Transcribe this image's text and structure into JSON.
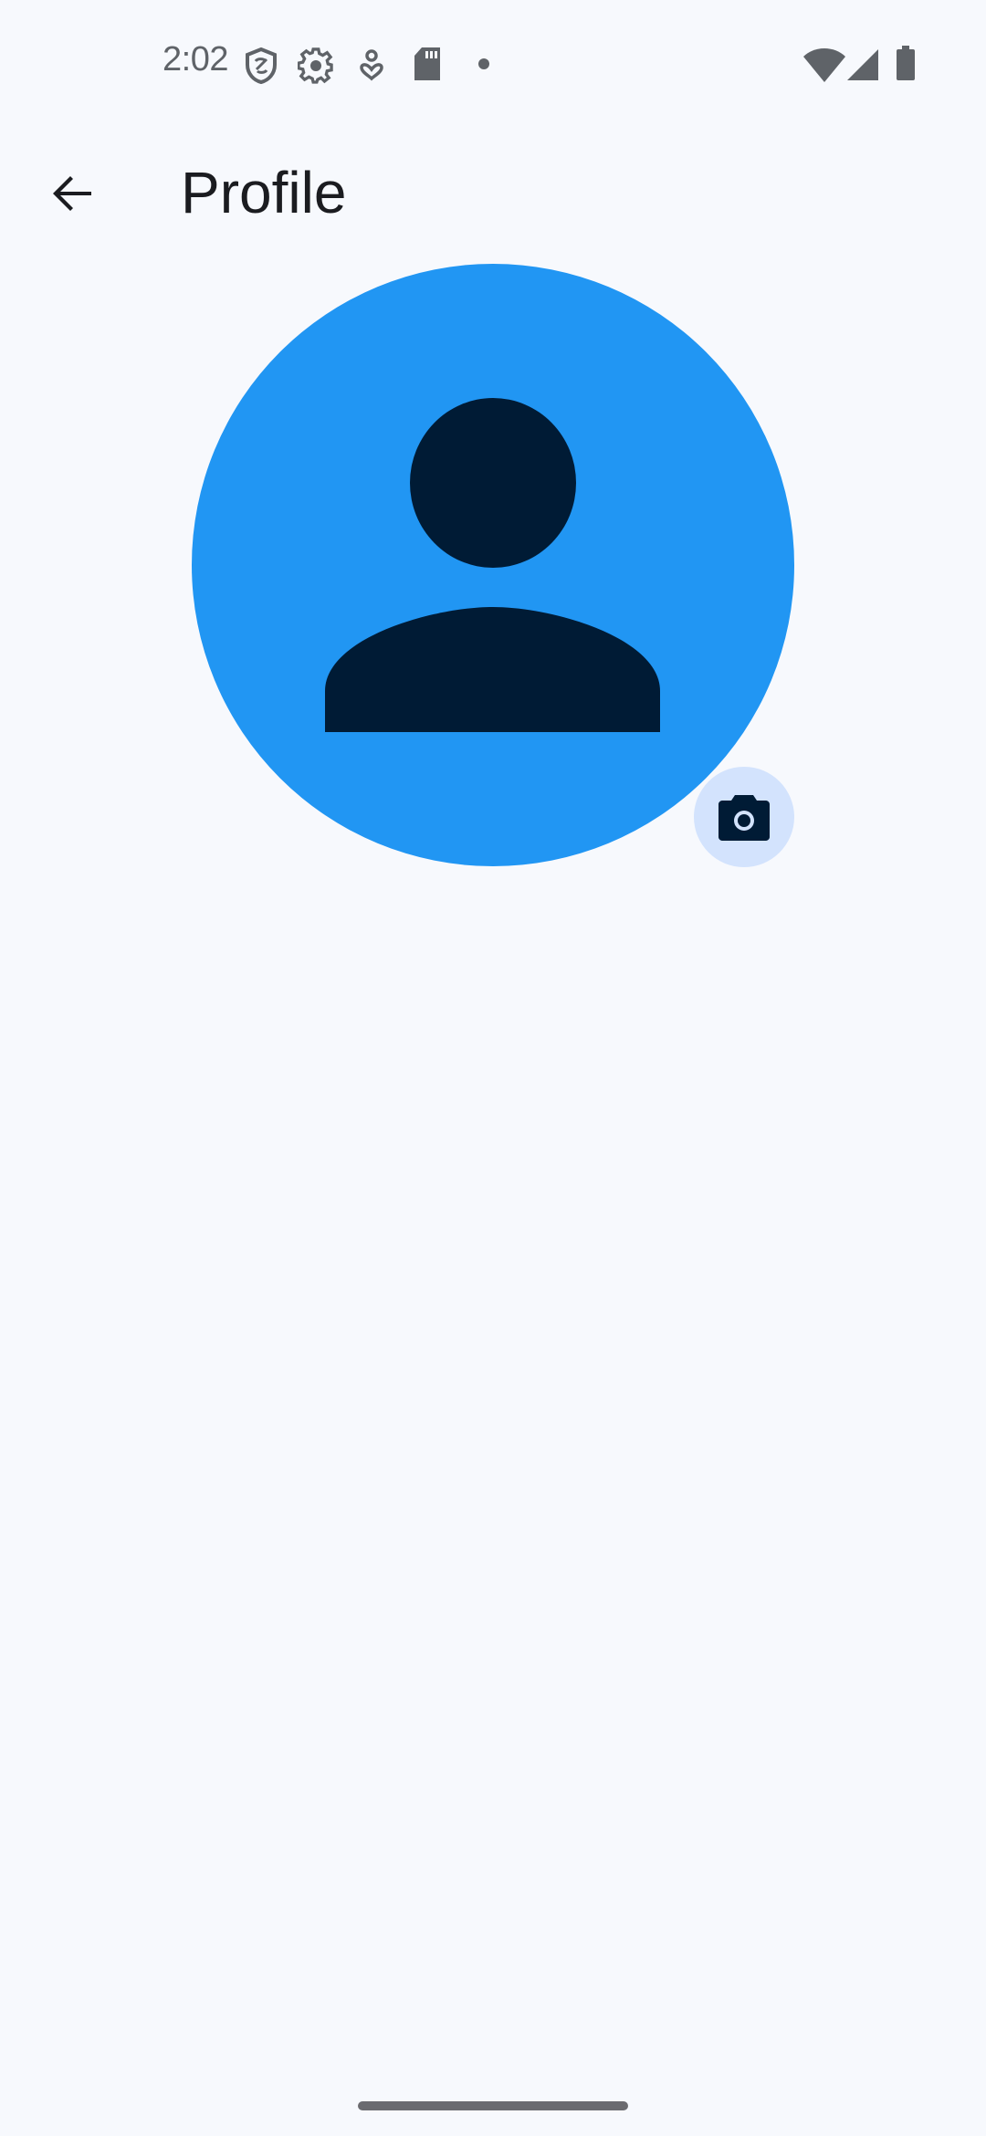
{
  "status_bar": {
    "time": "2:02",
    "left_icons": [
      "shield-icon",
      "settings-icon",
      "accessibility-icon",
      "sd-card-icon",
      "dot-icon"
    ],
    "right_icons": [
      "wifi-icon",
      "signal-icon",
      "battery-icon"
    ]
  },
  "app_bar": {
    "title": "Profile",
    "back_icon": "arrow-back-icon"
  },
  "profile": {
    "avatar_icon": "person-icon",
    "avatar_color": "#2196f3",
    "camera_button_icon": "camera-icon"
  }
}
